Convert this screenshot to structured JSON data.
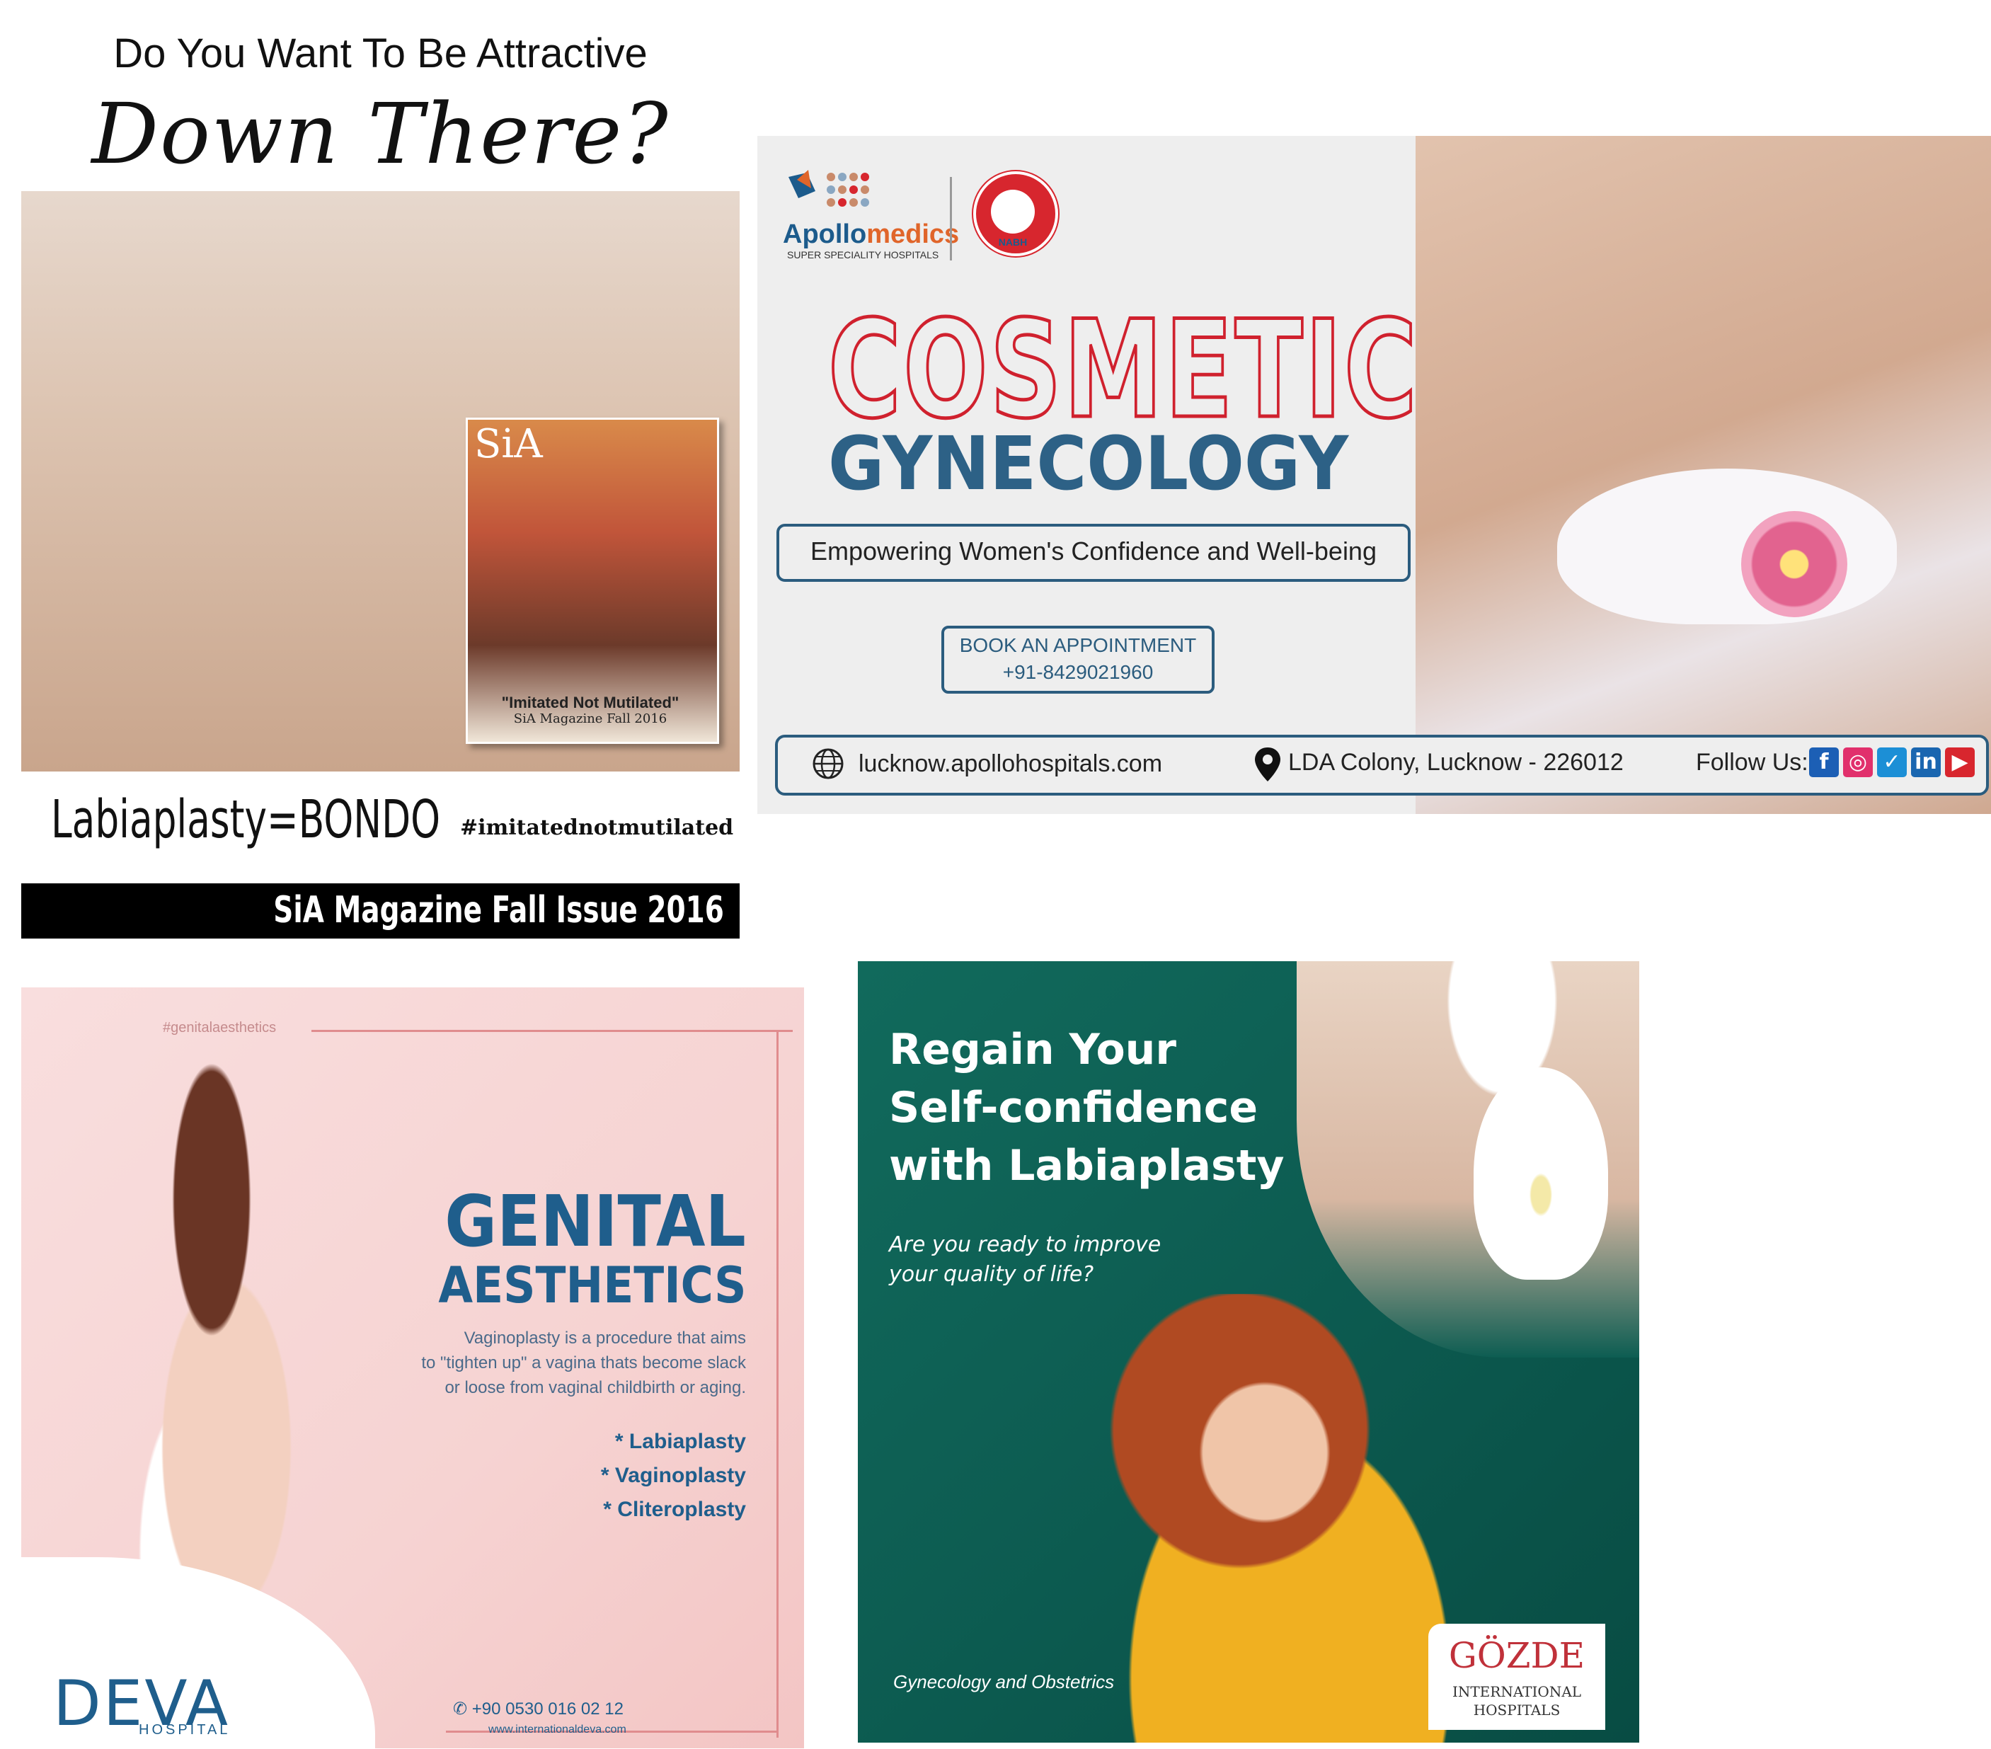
{
  "sia": {
    "headline": "Do You Want To Be Attractive",
    "script_line": "Down There?",
    "cover_title": "SiA",
    "cover_quote": "\"Imitated Not Mutilated\"",
    "cover_issue": "SiA Magazine Fall 2016",
    "tagline": "Labiaplasty=BONDO",
    "hashtag": "#imitatednotmutilated",
    "footer": "SiA Magazine Fall Issue 2016"
  },
  "apollo": {
    "brand_main": "Apollo",
    "brand_accent": "medics",
    "brand_sub": "SUPER SPECIALITY HOSPITALS",
    "accreditation": "NABH",
    "headline_1": "COSMETIC",
    "headline_2": "GYNECOLOGY",
    "slogan": "Empowering Women's Confidence and Well-being",
    "cta": "BOOK AN APPOINTMENT",
    "phone": "+91-8429021960",
    "website": "lucknow.apollohospitals.com",
    "address": "LDA Colony, Lucknow - 226012",
    "follow_label": "Follow Us:",
    "social_icons": [
      "facebook-icon",
      "instagram-icon",
      "twitter-icon",
      "linkedin-icon",
      "youtube-icon"
    ],
    "colors": {
      "red": "#d0212e",
      "blue": "#2d6186"
    }
  },
  "deva": {
    "hashtag": "#genitalaesthetics",
    "headline_1": "GENITAL",
    "headline_2": "AESTHETICS",
    "description": [
      "Vaginoplasty is a procedure that aims",
      "to \"tighten up\" a vagina thats become slack",
      "or loose from vaginal childbirth or aging."
    ],
    "procedures": [
      "* Labiaplasty",
      "* Vaginoplasty",
      "* Cliteroplasty"
    ],
    "logo": "DEVA",
    "logo_sub": "HOSPITAL",
    "phone": "+90 0530 016 02 12",
    "website": "www.internationaldeva.com"
  },
  "gozde": {
    "title_lines": [
      "Regain Your",
      "Self-confidence",
      "with Labiaplasty"
    ],
    "subtitle_lines": [
      "Are you ready to improve",
      "your quality of life?"
    ],
    "footer": "Gynecology and Obstetrics",
    "logo": "GÖZDE",
    "logo_line_1": "INTERNATIONAL",
    "logo_line_2": "HOSPITALS"
  }
}
